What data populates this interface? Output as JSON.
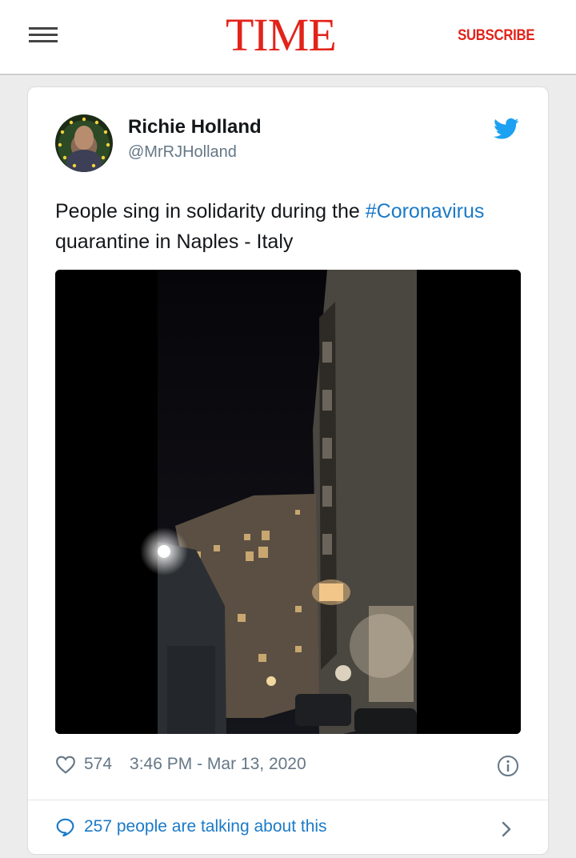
{
  "header": {
    "logo": "TIME",
    "subscribe_label": "SUBSCRIBE",
    "menu_icon": "hamburger-menu-icon",
    "brand_color": "#e2231a"
  },
  "tweet": {
    "author_name": "Richie Holland",
    "author_handle": "@MrRJHolland",
    "text_before": "People sing in solidarity during the ",
    "hashtag": "#Coronavirus",
    "text_after": " quarantine in Naples - Italy",
    "likes": "574",
    "timestamp": "3:46 PM - Mar 13, 2020",
    "talking_label": "257 people are talking about this",
    "platform_icon": "twitter-bird-icon",
    "link_color": "#1b7ac7"
  }
}
